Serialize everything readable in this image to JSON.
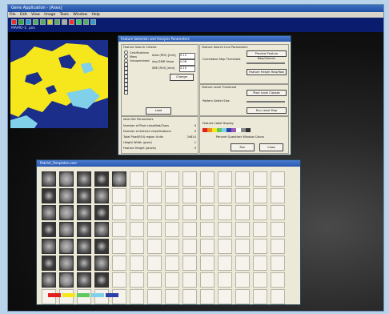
{
  "window": {
    "title": "Gene Application - [Axes]",
    "menus": [
      "File",
      "Edit",
      "View",
      "Image",
      "Tools",
      "Window",
      "Help"
    ],
    "secondary_bar": "MAMO-1: pos"
  },
  "dialog": {
    "title": "Feature Selection and Analysis Parameters",
    "group1_title": "Feature Search Criteria",
    "radio_options": [
      "Calcifications",
      "Mass",
      "Unsupervised"
    ],
    "fields": [
      {
        "label": "Area (ROI)  [mm]",
        "value": "0.12"
      },
      {
        "label": "Avg DMR Value",
        "value": "0.08"
      },
      {
        "label": "SBE (ROI) [mm]",
        "value": "0.10"
      }
    ],
    "change_label": "Change",
    "load_label": "Load",
    "group2_title": "Feature Search Line Parameters",
    "cm_threshold_label": "Correlation Map Threshold",
    "feature_level_label": "Feature Level Threshold",
    "pattern_select_label": "Pattern Select Size",
    "top_btn1": "Preview Feature Row/Column",
    "top_btn2": "Feature Height Row/Row",
    "mid_btn1": "Pixel Level Classes",
    "mid_btn2": "Run Level Map",
    "color_label": "Feature Label Display",
    "mask_label": "Percent Quantizer Window Colors",
    "stats_title": "Ideal Set Parameters",
    "stats": [
      {
        "label": "Number of Pixel classified/Class",
        "value": "9"
      },
      {
        "label": "Number of distinct classifications",
        "value": "9"
      },
      {
        "label": "Total Pixel(ROI) region Units",
        "value": "24614"
      },
      {
        "label": "Height Width (pixel)",
        "value": "1"
      },
      {
        "label": "Feature Height (pixels)",
        "value": "9"
      }
    ],
    "run_label": "Run",
    "close_label": "Close"
  },
  "thumbnail_window": {
    "title": "PatchA_Templates.cam",
    "rows": 8,
    "cols": 14
  },
  "colors": {
    "map_blue": "#1b2e8a",
    "map_yellow": "#f6e71c",
    "map_cyan": "#7fd0e8",
    "palette": [
      "#e01f1f",
      "#f6e71c",
      "#5ec95e",
      "#7fd0e8",
      "#2b3fa8"
    ]
  }
}
